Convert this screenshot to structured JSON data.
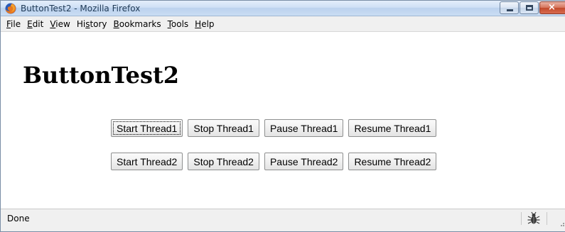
{
  "window": {
    "title": "ButtonTest2 - Mozilla Firefox",
    "app_icon": "firefox-icon",
    "controls": [
      "minimize-icon",
      "maximize-icon",
      "close-icon"
    ],
    "close_color": "#c24a2c"
  },
  "menubar": {
    "items": [
      {
        "label": "File"
      },
      {
        "label": "Edit"
      },
      {
        "label": "View"
      },
      {
        "label": "History"
      },
      {
        "label": "Bookmarks"
      },
      {
        "label": "Tools"
      },
      {
        "label": "Help"
      }
    ]
  },
  "page": {
    "title": "ButtonTest2",
    "rows": [
      {
        "buttons": [
          {
            "label": "Start Thread1",
            "focused": true
          },
          {
            "label": "Stop Thread1"
          },
          {
            "label": "Pause Thread1"
          },
          {
            "label": "Resume Thread1"
          }
        ]
      },
      {
        "buttons": [
          {
            "label": "Start Thread2"
          },
          {
            "label": "Stop Thread2"
          },
          {
            "label": "Pause Thread2"
          },
          {
            "label": "Resume Thread2"
          }
        ]
      }
    ]
  },
  "statusbar": {
    "text": "Done",
    "icons": [
      "bug-icon",
      "resize-grip-icon"
    ]
  }
}
